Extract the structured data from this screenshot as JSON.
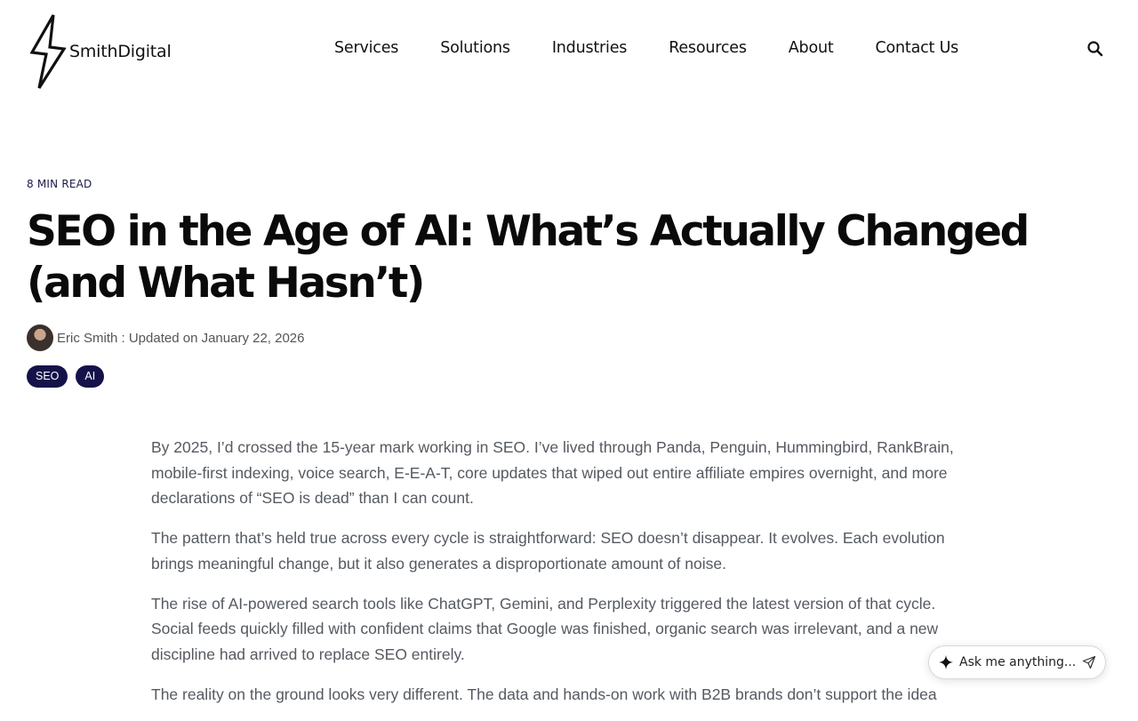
{
  "header": {
    "logo_text": "SmithDigital",
    "nav": [
      "Services",
      "Solutions",
      "Industries",
      "Resources",
      "About",
      "Contact Us"
    ],
    "search_icon": "search-icon"
  },
  "article": {
    "read_time": "8 MIN READ",
    "title": "SEO in the Age of AI: What’s Actually Changed (and What Hasn’t)",
    "byline": "Eric Smith : Updated on January 22, 2026",
    "tags": [
      "SEO",
      "AI"
    ],
    "paragraphs": [
      "By 2025, I’d crossed the 15-year mark working in SEO. I’ve lived through Panda, Penguin, Hummingbird, RankBrain, mobile-first indexing, voice search, E-E-A-T, core updates that wiped out entire affiliate empires overnight, and more declarations of “SEO is dead” than I can count.",
      "The pattern that’s held true across every cycle is straightforward: SEO doesn’t disappear. It evolves. Each evolution brings meaningful change, but it also generates a disproportionate amount of noise.",
      "The rise of AI-powered search tools like ChatGPT, Gemini, and Perplexity triggered the latest version of that cycle. Social feeds quickly filled with confident claims that Google was finished, organic search was irrelevant, and a new discipline had arrived to replace SEO entirely.",
      "The reality on the ground looks very different. The data and hands-on work with B2B brands don’t support the idea"
    ]
  },
  "assistant": {
    "placeholder": "Ask me anything...",
    "icons": [
      "sparkle-icon",
      "send-icon"
    ]
  },
  "colors": {
    "tag_bg": "#15124a",
    "body_text": "#555a61",
    "title_text": "#0a0a0a"
  }
}
